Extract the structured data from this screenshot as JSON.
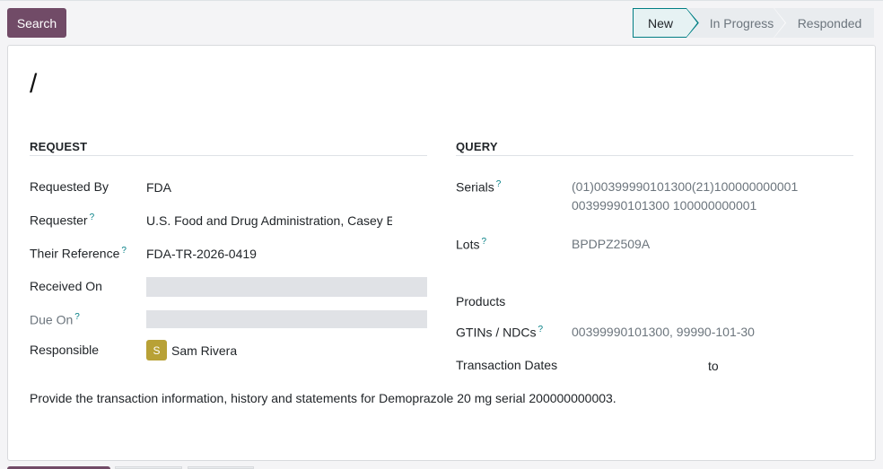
{
  "control_panel": {
    "search_label": "Search",
    "stages": [
      {
        "label": "New",
        "active": true
      },
      {
        "label": "In Progress",
        "active": false
      },
      {
        "label": "Responded",
        "active": false
      }
    ]
  },
  "record": {
    "name": "/"
  },
  "request": {
    "section_title": "REQUEST",
    "requested_by_label": "Requested By",
    "requested_by": "FDA",
    "requester_label": "Requester",
    "requester": "U.S. Food and Drug Administration, Casey E",
    "their_reference_label": "Their Reference",
    "their_reference": "FDA-TR-2026-0419",
    "received_on_label": "Received On",
    "received_on": "",
    "due_on_label": "Due On",
    "due_on": "",
    "responsible_label": "Responsible",
    "responsible_initial": "S",
    "responsible": "Sam Rivera"
  },
  "query": {
    "section_title": "QUERY",
    "serials_label": "Serials",
    "serials_line1": "(01)00399990101300(21)100000000001",
    "serials_line2": "00399990101300 100000000001",
    "lots_label": "Lots",
    "lots": "BPDPZ2509A",
    "products_label": "Products",
    "gtins_label": "GTINs / NDCs",
    "gtins": "00399990101300, 99990-101-30",
    "transaction_dates_label": "Transaction Dates",
    "dates_to": "to"
  },
  "help_marker": "?",
  "note": "Provide the transaction information, history and statements for Demoprazole 20 mg serial 200000000003.",
  "colors": {
    "brand": "#714b67",
    "accent": "#017e84",
    "avatar": "#b8a136"
  }
}
